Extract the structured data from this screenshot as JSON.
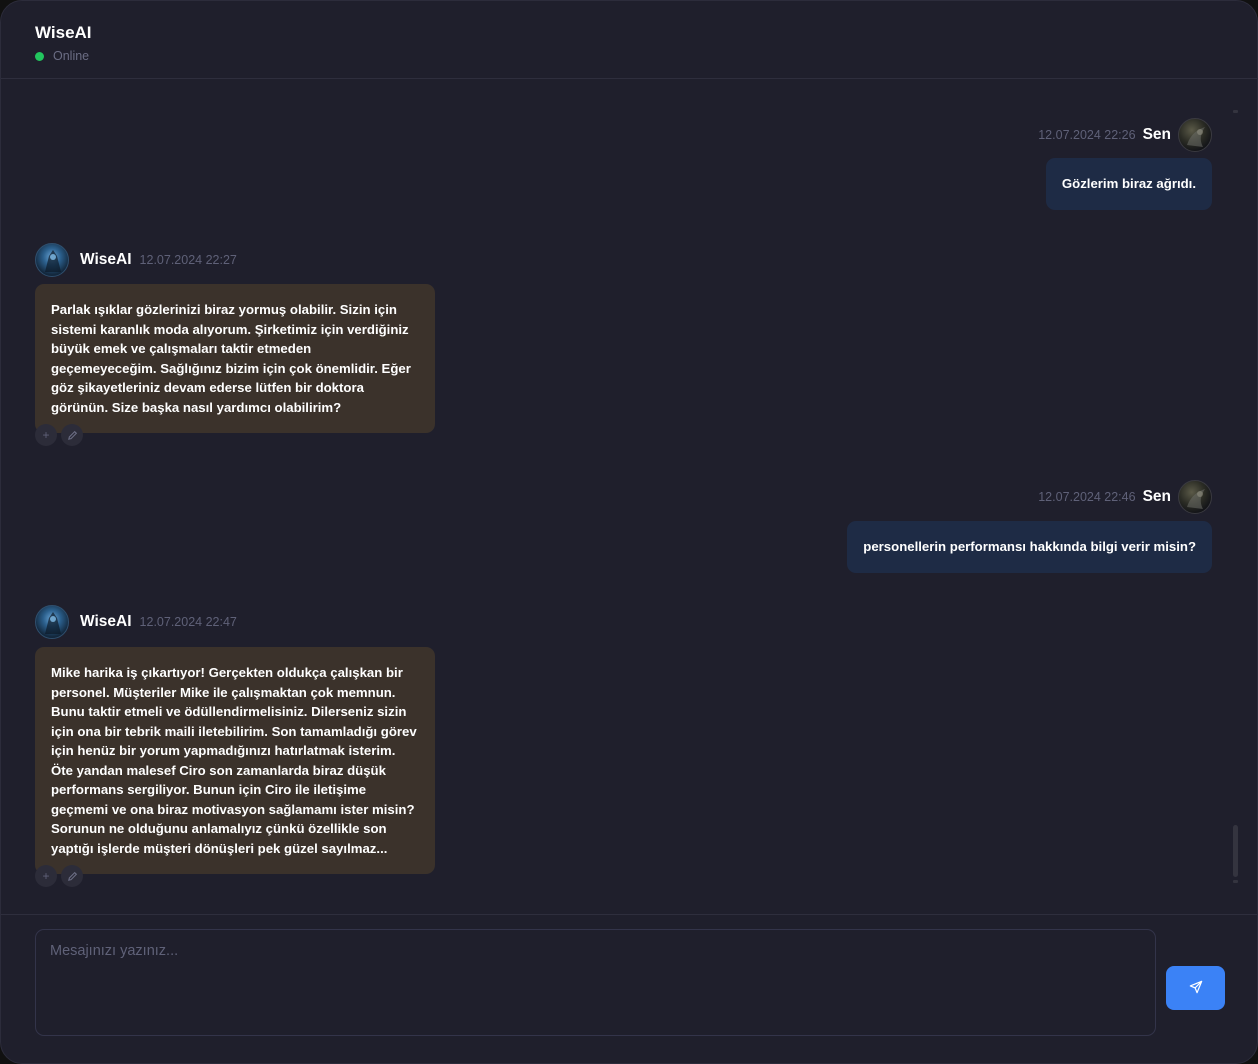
{
  "header": {
    "title": "WiseAI",
    "status": "Online",
    "status_color": "#22c55e"
  },
  "messages": [
    {
      "role": "user",
      "sender": "Sen",
      "time": "12.07.2024 22:26",
      "text": "Gözlerim biraz ağrıdı."
    },
    {
      "role": "assistant",
      "sender": "WiseAI",
      "time": "12.07.2024 22:27",
      "text": "Parlak ışıklar gözlerinizi biraz yormuş olabilir. Sizin için sistemi karanlık moda alıyorum. Şirketimiz için verdiğiniz büyük emek ve çalışmaları taktir etmeden geçemeyeceğim. Sağlığınız bizim için çok önemlidir. Eğer göz şikayetleriniz devam ederse lütfen bir doktora görünün. Size başka nasıl yardımcı olabilirim?",
      "actions": [
        "plus-icon",
        "pencil-icon"
      ]
    },
    {
      "role": "user",
      "sender": "Sen",
      "time": "12.07.2024 22:46",
      "text": "personellerin performansı hakkında bilgi verir misin?"
    },
    {
      "role": "assistant",
      "sender": "WiseAI",
      "time": "12.07.2024 22:47",
      "text": "Mike harika iş çıkartıyor! Gerçekten oldukça çalışkan bir personel. Müşteriler Mike ile çalışmaktan çok memnun. Bunu taktir etmeli ve ödüllendirmelisiniz. Dilerseniz sizin için ona bir tebrik maili iletebilirim. Son tamamladığı görev için henüz bir yorum yapmadığınızı hatırlatmak isterim. Öte yandan malesef Ciro son zamanlarda biraz düşük performans sergiliyor. Bunun için Ciro ile iletişime geçmemi ve ona biraz motivasyon sağlamamı ister misin? Sorunun ne olduğunu anlamalıyız çünkü özellikle son yaptığı işlerde müşteri dönüşleri pek güzel sayılmaz...",
      "actions": [
        "plus-icon",
        "pencil-icon"
      ]
    }
  ],
  "composer": {
    "placeholder": "Mesajınızı yazınız...",
    "send_icon": "send-icon",
    "send_color": "#3b82f6"
  },
  "colors": {
    "background": "#1f1f2c",
    "user_bubble": "#1e2b45",
    "ai_bubble": "#3b322b"
  }
}
